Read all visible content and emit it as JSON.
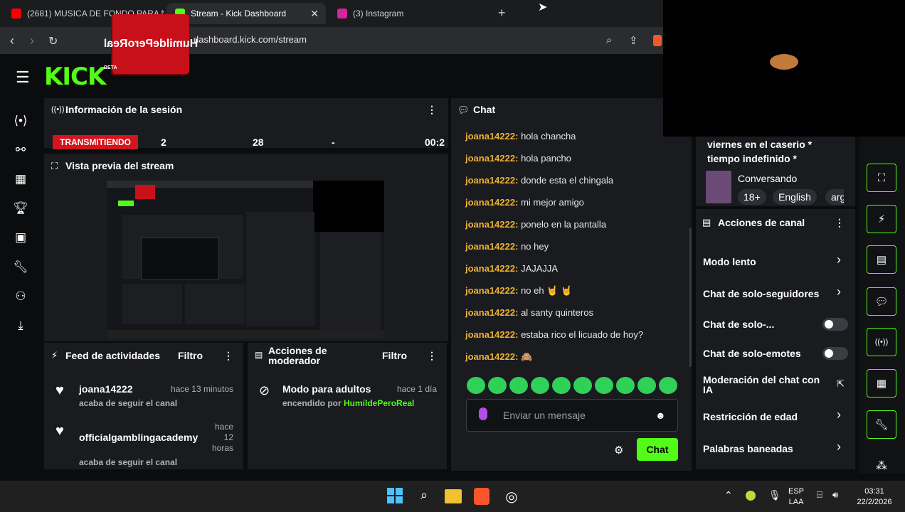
{
  "browser": {
    "tabs": [
      {
        "label": "(2681) MUSICA DE FONDO PARA NO",
        "favicon_color": "#ff0000"
      },
      {
        "label": "Stream - Kick Dashboard",
        "favicon_color": "#53fc18"
      },
      {
        "label": "(3) Instagram",
        "favicon_color": "#d6249f"
      }
    ],
    "new_tab": "+",
    "url": "dashboard.kick.com/stream",
    "sticker_text": "HumildePeroReal"
  },
  "app": {
    "logo": "KICK",
    "beta": "BETA",
    "accent": "#53fc18"
  },
  "session": {
    "title": "Información de la sesión",
    "live_badge": "TRANSMITIENDO",
    "stats": [
      "2",
      "28",
      "-",
      "00:2"
    ]
  },
  "preview": {
    "title": "Vista previa del stream"
  },
  "feed": {
    "title": "Feed de actividades",
    "filter": "Filtro",
    "items": [
      {
        "name": "joana14222",
        "time": "hace 13 minutos",
        "sub": "acaba de seguir el canal"
      },
      {
        "name": "officialgamblingacademy",
        "time_lines": [
          "hace",
          "12",
          "horas"
        ],
        "sub": "acaba de seguir el canal"
      }
    ]
  },
  "modactions": {
    "title_lines": [
      "Acciones de",
      "moderador"
    ],
    "filter": "Filtro",
    "item": {
      "title": "Modo para adultos",
      "time": "hace 1 día",
      "sub_prefix": "encendido por",
      "sub_user": "HumildePeroReal"
    }
  },
  "chat": {
    "title": "Chat",
    "messages": [
      {
        "user": "joana14222:",
        "text": "hola chancha"
      },
      {
        "user": "joana14222:",
        "text": "hola pancho"
      },
      {
        "user": "joana14222:",
        "text": "donde esta el chingala"
      },
      {
        "user": "joana14222:",
        "text": "mi mejor amigo"
      },
      {
        "user": "joana14222:",
        "text": "ponelo en la pantalla"
      },
      {
        "user": "joana14222:",
        "text": "no hey"
      },
      {
        "user": "joana14222:",
        "text": "JAJAJJA"
      },
      {
        "user": "joana14222:",
        "text": "no eh 🤘 🤘"
      },
      {
        "user": "joana14222:",
        "text": "al santy quinteros"
      },
      {
        "user": "joana14222:",
        "text": "estaba rico el licuado de hoy?"
      },
      {
        "user": "joana14222:",
        "text": "🙈"
      }
    ],
    "input_placeholder": "Enviar un mensaje",
    "send_label": "Chat"
  },
  "stream_info": {
    "title_lines": [
      "viernes en el caserio *",
      "tiempo indefinido *"
    ],
    "category": "Conversando",
    "tags": [
      "18+",
      "English",
      "arg"
    ]
  },
  "channel_actions": {
    "title": "Acciones de canal",
    "items": [
      {
        "label": "Modo lento",
        "control": "chevron"
      },
      {
        "label": "Chat de solo-seguidores",
        "control": "chevron"
      },
      {
        "label": "Chat de solo-...",
        "control": "toggle"
      },
      {
        "label": "Chat de solo-emotes",
        "control": "toggle"
      },
      {
        "label_lines": [
          "Moderación del chat con",
          "IA"
        ],
        "control": "external"
      },
      {
        "label": "Restricción de edad",
        "control": "chevron"
      },
      {
        "label": "Palabras baneadas",
        "control": "chevron"
      }
    ]
  },
  "taskbar": {
    "lang": "ESP",
    "layout": "LAA",
    "time": "03:31",
    "date": "22/2/2026"
  }
}
